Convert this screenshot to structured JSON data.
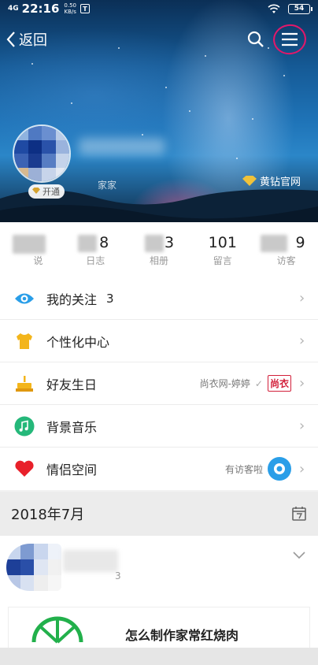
{
  "statusbar": {
    "network": "4G",
    "time": "22:16",
    "speed_value": "0.50",
    "speed_unit": "KB/s",
    "sim_badge": "T",
    "battery": "54"
  },
  "header": {
    "back_label": "返回"
  },
  "profile": {
    "subname": "家家",
    "open_badge": "开通",
    "vip_label": "黄钻官网"
  },
  "stats": [
    {
      "num": "",
      "label": "说"
    },
    {
      "num": "8",
      "label": "日志"
    },
    {
      "num": "3",
      "label": "相册"
    },
    {
      "num": "101",
      "label": "留言"
    },
    {
      "num": "9",
      "label": "访客"
    }
  ],
  "menu": [
    {
      "label": "我的关注",
      "count": "3",
      "icon": "eye-icon"
    },
    {
      "label": "个性化中心",
      "icon": "shirt-icon"
    },
    {
      "label": "好友生日",
      "right_text": "尚衣网-婷婷",
      "brand": "尚衣",
      "icon": "cake-icon"
    },
    {
      "label": "背景音乐",
      "icon": "music-icon"
    },
    {
      "label": "情侣空间",
      "right_text": "有访客啦",
      "icon": "heart-icon"
    }
  ],
  "section": {
    "date": "2018年7月"
  },
  "feed": {
    "sub_text": "3",
    "card_title": "怎么制作家常红烧肉"
  },
  "colors": {
    "accent_blue": "#2a9ee8",
    "heart_red": "#e8202a",
    "gold": "#f3b51b",
    "green": "#25b87a",
    "circle_mark": "#e0186a"
  }
}
